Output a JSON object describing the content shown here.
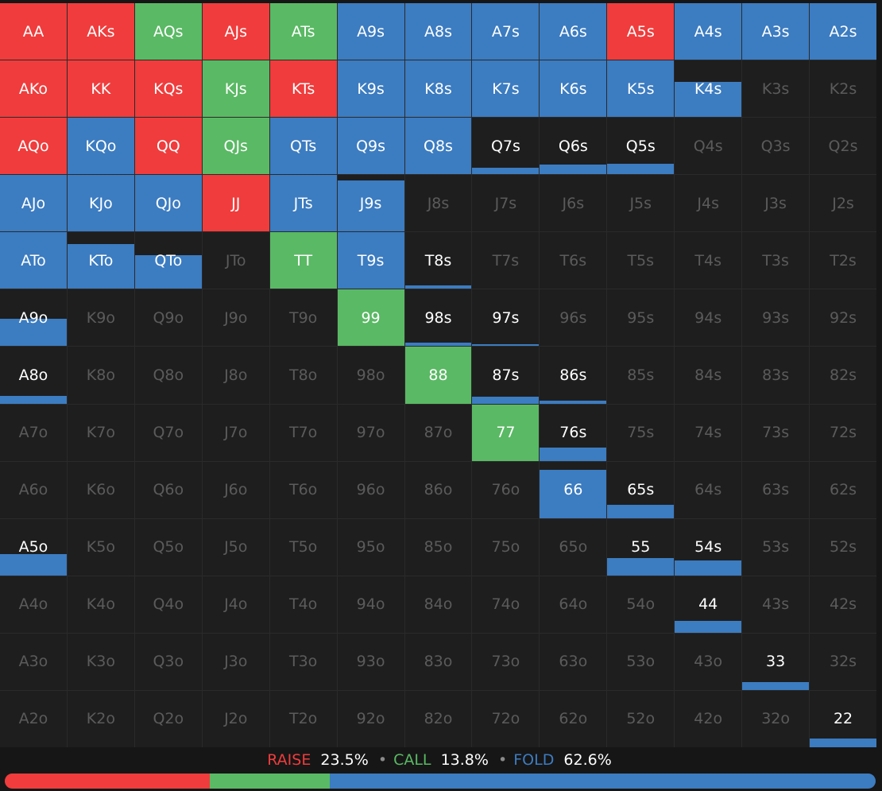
{
  "colors": {
    "raise": "#f03c3c",
    "call": "#5ab964",
    "fold": "#3c7cc1"
  },
  "ranks": [
    "A",
    "K",
    "Q",
    "J",
    "T",
    "9",
    "8",
    "7",
    "6",
    "5",
    "4",
    "3",
    "2"
  ],
  "hands": [
    [
      {
        "l": "AA",
        "r": 100,
        "c": 0,
        "f": 0
      },
      {
        "l": "AKs",
        "r": 100,
        "c": 0,
        "f": 0
      },
      {
        "l": "AQs",
        "r": 0,
        "c": 100,
        "f": 0
      },
      {
        "l": "AJs",
        "r": 100,
        "c": 0,
        "f": 0
      },
      {
        "l": "ATs",
        "r": 0,
        "c": 100,
        "f": 0
      },
      {
        "l": "A9s",
        "r": 0,
        "c": 0,
        "f": 100
      },
      {
        "l": "A8s",
        "r": 0,
        "c": 0,
        "f": 100
      },
      {
        "l": "A7s",
        "r": 0,
        "c": 0,
        "f": 100
      },
      {
        "l": "A6s",
        "r": 0,
        "c": 0,
        "f": 100
      },
      {
        "l": "A5s",
        "r": 100,
        "c": 0,
        "f": 0
      },
      {
        "l": "A4s",
        "r": 0,
        "c": 0,
        "f": 100
      },
      {
        "l": "A3s",
        "r": 0,
        "c": 0,
        "f": 100
      },
      {
        "l": "A2s",
        "r": 0,
        "c": 0,
        "f": 100
      }
    ],
    [
      {
        "l": "AKo",
        "r": 100,
        "c": 0,
        "f": 0
      },
      {
        "l": "KK",
        "r": 100,
        "c": 0,
        "f": 0
      },
      {
        "l": "KQs",
        "r": 100,
        "c": 0,
        "f": 0
      },
      {
        "l": "KJs",
        "r": 0,
        "c": 100,
        "f": 0
      },
      {
        "l": "KTs",
        "r": 100,
        "c": 0,
        "f": 0
      },
      {
        "l": "K9s",
        "r": 0,
        "c": 0,
        "f": 100
      },
      {
        "l": "K8s",
        "r": 0,
        "c": 0,
        "f": 100
      },
      {
        "l": "K7s",
        "r": 0,
        "c": 0,
        "f": 100
      },
      {
        "l": "K6s",
        "r": 0,
        "c": 0,
        "f": 100
      },
      {
        "l": "K5s",
        "r": 0,
        "c": 0,
        "f": 100
      },
      {
        "l": "K4s",
        "r": 0,
        "c": 0,
        "f": 62
      },
      {
        "l": "K3s",
        "r": 0,
        "c": 0,
        "f": 0
      },
      {
        "l": "K2s",
        "r": 0,
        "c": 0,
        "f": 0
      }
    ],
    [
      {
        "l": "AQo",
        "r": 100,
        "c": 0,
        "f": 0
      },
      {
        "l": "KQo",
        "r": 0,
        "c": 0,
        "f": 100
      },
      {
        "l": "QQ",
        "r": 100,
        "c": 0,
        "f": 0
      },
      {
        "l": "QJs",
        "r": 0,
        "c": 100,
        "f": 0
      },
      {
        "l": "QTs",
        "r": 0,
        "c": 0,
        "f": 100
      },
      {
        "l": "Q9s",
        "r": 0,
        "c": 0,
        "f": 100
      },
      {
        "l": "Q8s",
        "r": 0,
        "c": 0,
        "f": 100
      },
      {
        "l": "Q7s",
        "r": 0,
        "c": 0,
        "f": 12
      },
      {
        "l": "Q6s",
        "r": 0,
        "c": 0,
        "f": 17
      },
      {
        "l": "Q5s",
        "r": 0,
        "c": 0,
        "f": 19
      },
      {
        "l": "Q4s",
        "r": 0,
        "c": 0,
        "f": 0
      },
      {
        "l": "Q3s",
        "r": 0,
        "c": 0,
        "f": 0
      },
      {
        "l": "Q2s",
        "r": 0,
        "c": 0,
        "f": 0
      }
    ],
    [
      {
        "l": "AJo",
        "r": 0,
        "c": 0,
        "f": 100
      },
      {
        "l": "KJo",
        "r": 0,
        "c": 0,
        "f": 100
      },
      {
        "l": "QJo",
        "r": 0,
        "c": 0,
        "f": 100
      },
      {
        "l": "JJ",
        "r": 100,
        "c": 0,
        "f": 0
      },
      {
        "l": "JTs",
        "r": 0,
        "c": 0,
        "f": 100
      },
      {
        "l": "J9s",
        "r": 0,
        "c": 0,
        "f": 90
      },
      {
        "l": "J8s",
        "r": 0,
        "c": 0,
        "f": 0
      },
      {
        "l": "J7s",
        "r": 0,
        "c": 0,
        "f": 0
      },
      {
        "l": "J6s",
        "r": 0,
        "c": 0,
        "f": 0
      },
      {
        "l": "J5s",
        "r": 0,
        "c": 0,
        "f": 0
      },
      {
        "l": "J4s",
        "r": 0,
        "c": 0,
        "f": 0
      },
      {
        "l": "J3s",
        "r": 0,
        "c": 0,
        "f": 0
      },
      {
        "l": "J2s",
        "r": 0,
        "c": 0,
        "f": 0
      }
    ],
    [
      {
        "l": "ATo",
        "r": 0,
        "c": 0,
        "f": 100
      },
      {
        "l": "KTo",
        "r": 0,
        "c": 0,
        "f": 80
      },
      {
        "l": "QTo",
        "r": 0,
        "c": 0,
        "f": 60
      },
      {
        "l": "JTo",
        "r": 0,
        "c": 0,
        "f": 0
      },
      {
        "l": "TT",
        "r": 0,
        "c": 100,
        "f": 0
      },
      {
        "l": "T9s",
        "r": 0,
        "c": 0,
        "f": 100
      },
      {
        "l": "T8s",
        "r": 0,
        "c": 0,
        "f": 6
      },
      {
        "l": "T7s",
        "r": 0,
        "c": 0,
        "f": 0
      },
      {
        "l": "T6s",
        "r": 0,
        "c": 0,
        "f": 0
      },
      {
        "l": "T5s",
        "r": 0,
        "c": 0,
        "f": 0
      },
      {
        "l": "T4s",
        "r": 0,
        "c": 0,
        "f": 0
      },
      {
        "l": "T3s",
        "r": 0,
        "c": 0,
        "f": 0
      },
      {
        "l": "T2s",
        "r": 0,
        "c": 0,
        "f": 0
      }
    ],
    [
      {
        "l": "A9o",
        "r": 0,
        "c": 0,
        "f": 48
      },
      {
        "l": "K9o",
        "r": 0,
        "c": 0,
        "f": 0
      },
      {
        "l": "Q9o",
        "r": 0,
        "c": 0,
        "f": 0
      },
      {
        "l": "J9o",
        "r": 0,
        "c": 0,
        "f": 0
      },
      {
        "l": "T9o",
        "r": 0,
        "c": 0,
        "f": 0
      },
      {
        "l": "99",
        "r": 0,
        "c": 100,
        "f": 0
      },
      {
        "l": "98s",
        "r": 0,
        "c": 0,
        "f": 6
      },
      {
        "l": "97s",
        "r": 0,
        "c": 0,
        "f": 3
      },
      {
        "l": "96s",
        "r": 0,
        "c": 0,
        "f": 0
      },
      {
        "l": "95s",
        "r": 0,
        "c": 0,
        "f": 0
      },
      {
        "l": "94s",
        "r": 0,
        "c": 0,
        "f": 0
      },
      {
        "l": "93s",
        "r": 0,
        "c": 0,
        "f": 0
      },
      {
        "l": "92s",
        "r": 0,
        "c": 0,
        "f": 0
      }
    ],
    [
      {
        "l": "A8o",
        "r": 0,
        "c": 0,
        "f": 13
      },
      {
        "l": "K8o",
        "r": 0,
        "c": 0,
        "f": 0
      },
      {
        "l": "Q8o",
        "r": 0,
        "c": 0,
        "f": 0
      },
      {
        "l": "J8o",
        "r": 0,
        "c": 0,
        "f": 0
      },
      {
        "l": "T8o",
        "r": 0,
        "c": 0,
        "f": 0
      },
      {
        "l": "98o",
        "r": 0,
        "c": 0,
        "f": 0
      },
      {
        "l": "88",
        "r": 0,
        "c": 100,
        "f": 0
      },
      {
        "l": "87s",
        "r": 0,
        "c": 0,
        "f": 12
      },
      {
        "l": "86s",
        "r": 0,
        "c": 0,
        "f": 5
      },
      {
        "l": "85s",
        "r": 0,
        "c": 0,
        "f": 0
      },
      {
        "l": "84s",
        "r": 0,
        "c": 0,
        "f": 0
      },
      {
        "l": "83s",
        "r": 0,
        "c": 0,
        "f": 0
      },
      {
        "l": "82s",
        "r": 0,
        "c": 0,
        "f": 0
      }
    ],
    [
      {
        "l": "A7o",
        "r": 0,
        "c": 0,
        "f": 0
      },
      {
        "l": "K7o",
        "r": 0,
        "c": 0,
        "f": 0
      },
      {
        "l": "Q7o",
        "r": 0,
        "c": 0,
        "f": 0
      },
      {
        "l": "J7o",
        "r": 0,
        "c": 0,
        "f": 0
      },
      {
        "l": "T7o",
        "r": 0,
        "c": 0,
        "f": 0
      },
      {
        "l": "97o",
        "r": 0,
        "c": 0,
        "f": 0
      },
      {
        "l": "87o",
        "r": 0,
        "c": 0,
        "f": 0
      },
      {
        "l": "77",
        "r": 0,
        "c": 100,
        "f": 0
      },
      {
        "l": "76s",
        "r": 0,
        "c": 0,
        "f": 24
      },
      {
        "l": "75s",
        "r": 0,
        "c": 0,
        "f": 0
      },
      {
        "l": "74s",
        "r": 0,
        "c": 0,
        "f": 0
      },
      {
        "l": "73s",
        "r": 0,
        "c": 0,
        "f": 0
      },
      {
        "l": "72s",
        "r": 0,
        "c": 0,
        "f": 0
      }
    ],
    [
      {
        "l": "A6o",
        "r": 0,
        "c": 0,
        "f": 0
      },
      {
        "l": "K6o",
        "r": 0,
        "c": 0,
        "f": 0
      },
      {
        "l": "Q6o",
        "r": 0,
        "c": 0,
        "f": 0
      },
      {
        "l": "J6o",
        "r": 0,
        "c": 0,
        "f": 0
      },
      {
        "l": "T6o",
        "r": 0,
        "c": 0,
        "f": 0
      },
      {
        "l": "96o",
        "r": 0,
        "c": 0,
        "f": 0
      },
      {
        "l": "86o",
        "r": 0,
        "c": 0,
        "f": 0
      },
      {
        "l": "76o",
        "r": 0,
        "c": 0,
        "f": 0
      },
      {
        "l": "66",
        "r": 0,
        "c": 0,
        "f": 85
      },
      {
        "l": "65s",
        "r": 0,
        "c": 0,
        "f": 24
      },
      {
        "l": "64s",
        "r": 0,
        "c": 0,
        "f": 0
      },
      {
        "l": "63s",
        "r": 0,
        "c": 0,
        "f": 0
      },
      {
        "l": "62s",
        "r": 0,
        "c": 0,
        "f": 0
      }
    ],
    [
      {
        "l": "A5o",
        "r": 0,
        "c": 0,
        "f": 37
      },
      {
        "l": "K5o",
        "r": 0,
        "c": 0,
        "f": 0
      },
      {
        "l": "Q5o",
        "r": 0,
        "c": 0,
        "f": 0
      },
      {
        "l": "J5o",
        "r": 0,
        "c": 0,
        "f": 0
      },
      {
        "l": "T5o",
        "r": 0,
        "c": 0,
        "f": 0
      },
      {
        "l": "95o",
        "r": 0,
        "c": 0,
        "f": 0
      },
      {
        "l": "85o",
        "r": 0,
        "c": 0,
        "f": 0
      },
      {
        "l": "75o",
        "r": 0,
        "c": 0,
        "f": 0
      },
      {
        "l": "65o",
        "r": 0,
        "c": 0,
        "f": 0
      },
      {
        "l": "55",
        "r": 0,
        "c": 0,
        "f": 30
      },
      {
        "l": "54s",
        "r": 0,
        "c": 0,
        "f": 27
      },
      {
        "l": "53s",
        "r": 0,
        "c": 0,
        "f": 0
      },
      {
        "l": "52s",
        "r": 0,
        "c": 0,
        "f": 0
      }
    ],
    [
      {
        "l": "A4o",
        "r": 0,
        "c": 0,
        "f": 0
      },
      {
        "l": "K4o",
        "r": 0,
        "c": 0,
        "f": 0
      },
      {
        "l": "Q4o",
        "r": 0,
        "c": 0,
        "f": 0
      },
      {
        "l": "J4o",
        "r": 0,
        "c": 0,
        "f": 0
      },
      {
        "l": "T4o",
        "r": 0,
        "c": 0,
        "f": 0
      },
      {
        "l": "94o",
        "r": 0,
        "c": 0,
        "f": 0
      },
      {
        "l": "84o",
        "r": 0,
        "c": 0,
        "f": 0
      },
      {
        "l": "74o",
        "r": 0,
        "c": 0,
        "f": 0
      },
      {
        "l": "64o",
        "r": 0,
        "c": 0,
        "f": 0
      },
      {
        "l": "54o",
        "r": 0,
        "c": 0,
        "f": 0
      },
      {
        "l": "44",
        "r": 0,
        "c": 0,
        "f": 21
      },
      {
        "l": "43s",
        "r": 0,
        "c": 0,
        "f": 0
      },
      {
        "l": "42s",
        "r": 0,
        "c": 0,
        "f": 0
      }
    ],
    [
      {
        "l": "A3o",
        "r": 0,
        "c": 0,
        "f": 0
      },
      {
        "l": "K3o",
        "r": 0,
        "c": 0,
        "f": 0
      },
      {
        "l": "Q3o",
        "r": 0,
        "c": 0,
        "f": 0
      },
      {
        "l": "J3o",
        "r": 0,
        "c": 0,
        "f": 0
      },
      {
        "l": "T3o",
        "r": 0,
        "c": 0,
        "f": 0
      },
      {
        "l": "93o",
        "r": 0,
        "c": 0,
        "f": 0
      },
      {
        "l": "83o",
        "r": 0,
        "c": 0,
        "f": 0
      },
      {
        "l": "73o",
        "r": 0,
        "c": 0,
        "f": 0
      },
      {
        "l": "63o",
        "r": 0,
        "c": 0,
        "f": 0
      },
      {
        "l": "53o",
        "r": 0,
        "c": 0,
        "f": 0
      },
      {
        "l": "43o",
        "r": 0,
        "c": 0,
        "f": 0
      },
      {
        "l": "33",
        "r": 0,
        "c": 0,
        "f": 14
      },
      {
        "l": "32s",
        "r": 0,
        "c": 0,
        "f": 0
      }
    ],
    [
      {
        "l": "A2o",
        "r": 0,
        "c": 0,
        "f": 0
      },
      {
        "l": "K2o",
        "r": 0,
        "c": 0,
        "f": 0
      },
      {
        "l": "Q2o",
        "r": 0,
        "c": 0,
        "f": 0
      },
      {
        "l": "J2o",
        "r": 0,
        "c": 0,
        "f": 0
      },
      {
        "l": "T2o",
        "r": 0,
        "c": 0,
        "f": 0
      },
      {
        "l": "92o",
        "r": 0,
        "c": 0,
        "f": 0
      },
      {
        "l": "82o",
        "r": 0,
        "c": 0,
        "f": 0
      },
      {
        "l": "72o",
        "r": 0,
        "c": 0,
        "f": 0
      },
      {
        "l": "62o",
        "r": 0,
        "c": 0,
        "f": 0
      },
      {
        "l": "52o",
        "r": 0,
        "c": 0,
        "f": 0
      },
      {
        "l": "42o",
        "r": 0,
        "c": 0,
        "f": 0
      },
      {
        "l": "32o",
        "r": 0,
        "c": 0,
        "f": 0
      },
      {
        "l": "22",
        "r": 0,
        "c": 0,
        "f": 16
      }
    ]
  ],
  "summary": {
    "raise_label": "RAISE",
    "raise_value": "23.5%",
    "call_label": "CALL",
    "call_value": "13.8%",
    "fold_label": "FOLD",
    "fold_value": "62.6%",
    "separator": "•"
  },
  "frequency_bar": {
    "raise_pct": 23.5,
    "call_pct": 13.8,
    "fold_pct": 62.6
  }
}
